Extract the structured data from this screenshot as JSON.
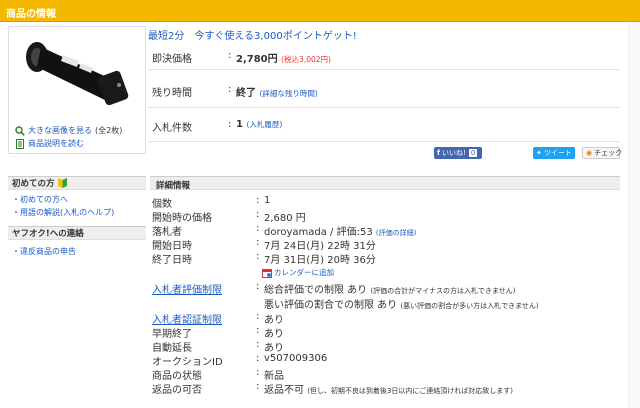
{
  "header": {
    "title": "商品の情報"
  },
  "promo": "最短2分　今すぐ使える3,000ポイントゲット!",
  "left": {
    "enlarge_link": "大きな画像を見る",
    "enlarge_count": "(全2枚)",
    "desc_link": "商品説明を読む"
  },
  "info": {
    "price_label": "即決価格",
    "price_value": "2,780円",
    "price_tax": "(税込3,002円)",
    "time_label": "残り時間",
    "time_value": "終了",
    "time_link": "(詳細な残り時間)",
    "bids_label": "入札件数",
    "bids_value": "1",
    "bids_link": "(入札履歴)"
  },
  "social": {
    "fb_label": "いいね!",
    "fb_count": "0",
    "tw_label": "ツイート",
    "check_label": "チェック"
  },
  "sidebar": {
    "section1_title": "初めての方",
    "section1_links": [
      "初めての方へ",
      "用語の解説(入札のヘルプ)"
    ],
    "section2_title": "ヤフオク!への連絡",
    "section2_links": [
      "違反商品の申告"
    ]
  },
  "details": {
    "title": "詳細情報",
    "rows": [
      {
        "label": "個数",
        "value": "1"
      },
      {
        "label": "開始時の価格",
        "value": "2,680 円"
      },
      {
        "label": "落札者",
        "value": "doroyamada / 評価:53",
        "link": "(評価の詳細)"
      },
      {
        "label": "開始日時",
        "value": "7月 24日(月) 22時 31分"
      },
      {
        "label": "終了日時",
        "value": "7月 31日(月) 20時 36分"
      }
    ],
    "calendar_link": "カレンダーに追加",
    "eval_label": "入札者評価制限",
    "eval_value1": "総合評価での制限 あり",
    "eval_note1": "(評価の合計がマイナスの方は入札できません)",
    "eval_value2": "悪い評価の割合での制限 あり",
    "eval_note2": "(悪い評価の割合が多い方は入札できません)",
    "auth_label": "入札者認証制限",
    "auth_value": "あり",
    "early_label": "早期終了",
    "early_value": "あり",
    "auto_label": "自動延長",
    "auto_value": "あり",
    "id_label": "オークションID",
    "id_value": "v507009306",
    "cond_label": "商品の状態",
    "cond_value": "新品",
    "return_label": "返品の可否",
    "return_value": "返品不可",
    "return_note": "(但し、初期不良は到着後3日以内にご連絡頂ければ対応致します)"
  },
  "colors": {
    "header": "#f5b800",
    "link": "#1b5ac2",
    "price_tax": "#ee3333"
  }
}
